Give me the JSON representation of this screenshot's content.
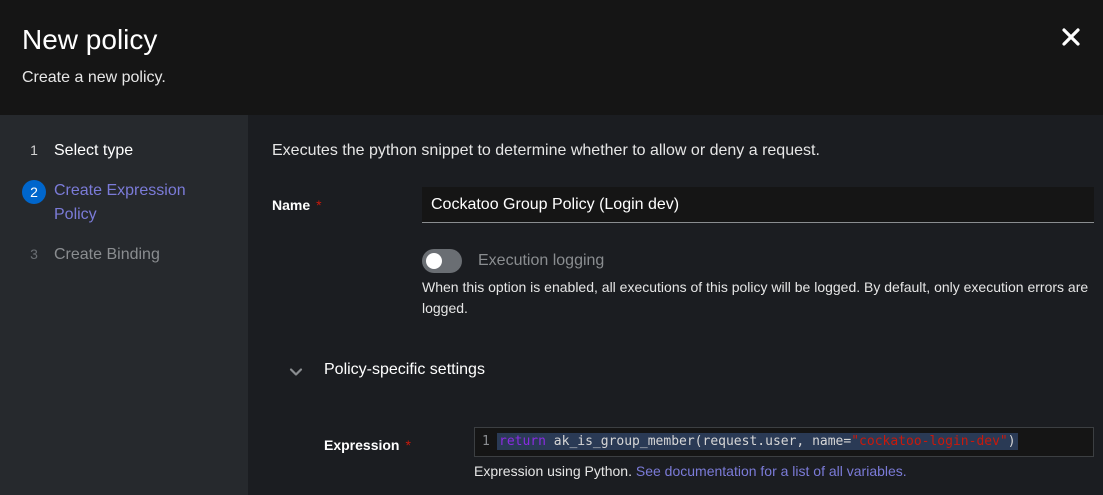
{
  "header": {
    "title": "New policy",
    "subtitle": "Create a new policy.",
    "close_icon": "close-icon"
  },
  "steps": [
    {
      "number": "1",
      "label": "Select type",
      "state": "complete"
    },
    {
      "number": "2",
      "label": "Create Expression Policy",
      "state": "current"
    },
    {
      "number": "3",
      "label": "Create Binding",
      "state": "disabled"
    }
  ],
  "main": {
    "description": "Executes the python snippet to determine whether to allow or deny a request.",
    "name_field": {
      "label": "Name",
      "required_marker": "*",
      "value": "Cockatoo Group Policy (Login dev)"
    },
    "execution_logging": {
      "label": "Execution logging",
      "enabled": false,
      "helper": "When this option is enabled, all executions of this policy will be logged. By default, only execution errors are logged."
    },
    "section": {
      "title": "Policy-specific settings",
      "expanded": true
    },
    "expression": {
      "label": "Expression",
      "required_marker": "*",
      "line_number": "1",
      "code_keyword": "return",
      "code_function": " ak_is_group_member(request.user, name=",
      "code_string": "\"cockatoo-login-dev\"",
      "code_end": ")",
      "helper_text": "Expression using Python.",
      "helper_link": "See documentation for a list of all variables."
    }
  },
  "colors": {
    "accent": "#0066cc",
    "link": "#7b7bd8",
    "required": "#c9190b"
  }
}
